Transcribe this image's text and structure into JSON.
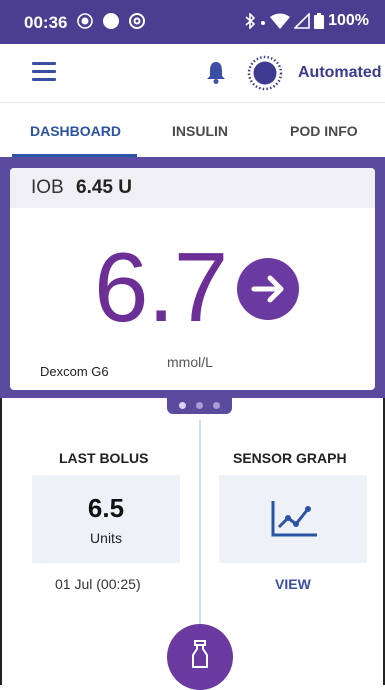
{
  "status_bar": {
    "time": "00:36",
    "battery": "100%",
    "icons": [
      "status-dot-icon",
      "status-circle-icon",
      "status-at-icon",
      "bluetooth-icon",
      "wifi-icon",
      "signal-icon",
      "battery-icon"
    ]
  },
  "app_bar": {
    "menu_icon": "hamburger-menu-icon",
    "bell_icon": "notification-bell-icon",
    "mode_icon": "automated-mode-icon",
    "mode_label": "Automated"
  },
  "tabs": [
    {
      "label": "DASHBOARD",
      "active": true
    },
    {
      "label": "INSULIN",
      "active": false
    },
    {
      "label": "POD INFO",
      "active": false
    }
  ],
  "glucose_card": {
    "iob_label": "IOB",
    "iob_value": "6.45 U",
    "glucose_value": "6.7",
    "trend_icon": "arrow-right-icon",
    "unit": "mmol/L",
    "sensor": "Dexcom G6"
  },
  "pager": {
    "count": 3,
    "active_index": 0
  },
  "last_bolus": {
    "title": "LAST BOLUS",
    "value": "6.5",
    "unit": "Units",
    "date": "01 Jul (00:25)"
  },
  "sensor_graph": {
    "title": "SENSOR GRAPH",
    "icon": "line-chart-icon",
    "link_label": "VIEW"
  },
  "fab": {
    "icon": "bolus-vial-icon"
  },
  "colors": {
    "status_bar": "#4b3d8f",
    "accent_blue": "#2b53a6",
    "purple_band": "#5a4b9e",
    "glucose_purple": "#6b2f96",
    "tile_bg": "#eef2f8"
  }
}
